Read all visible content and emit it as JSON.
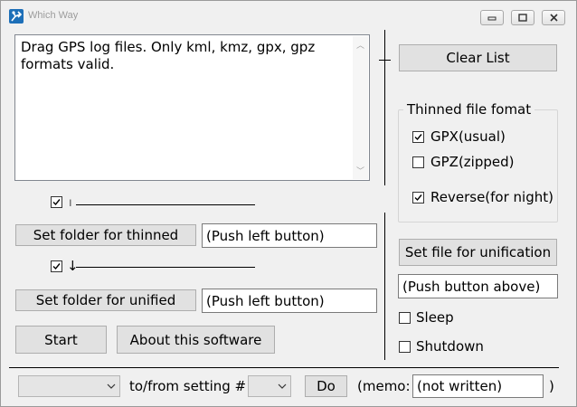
{
  "window": {
    "title": "Which Way",
    "icon": "which-way-app-icon",
    "controls": [
      "minimize-icon",
      "maximize-icon",
      "close-icon"
    ]
  },
  "drop_area": {
    "text": "Drag GPS log files. Only kml, kmz, gpx, gpz\nformats valid."
  },
  "clear_list": {
    "label": "Clear List"
  },
  "thin_row": {
    "checked": true,
    "marker": "ı"
  },
  "set_folder_thinned": {
    "label": "Set folder for thinned",
    "value": "(Push left button)"
  },
  "unify_row": {
    "checked": true,
    "marker": "↓"
  },
  "set_folder_unified": {
    "label": "Set folder for unified",
    "value": "(Push left button)"
  },
  "start": {
    "label": "Start"
  },
  "about": {
    "label": "About this software"
  },
  "thinned_format": {
    "title": "Thinned file fomat",
    "options": [
      {
        "label": "GPX(usual)",
        "checked": true
      },
      {
        "label": "GPZ(zipped)",
        "checked": false
      },
      {
        "label": "Reverse(for night)",
        "checked": true
      }
    ]
  },
  "set_file_unification": {
    "label": "Set file for unification",
    "value": "(Push button above)"
  },
  "sleep": {
    "label": "Sleep",
    "checked": false
  },
  "shutdown": {
    "label": "Shutdown",
    "checked": false
  },
  "bottom_bar": {
    "setting_select_value": "",
    "to_from_label": "to/from setting #",
    "setting_number_value": "",
    "do_label": "Do",
    "memo_label": "(memo:",
    "memo_value": "(not written)",
    "close_paren": ")"
  }
}
